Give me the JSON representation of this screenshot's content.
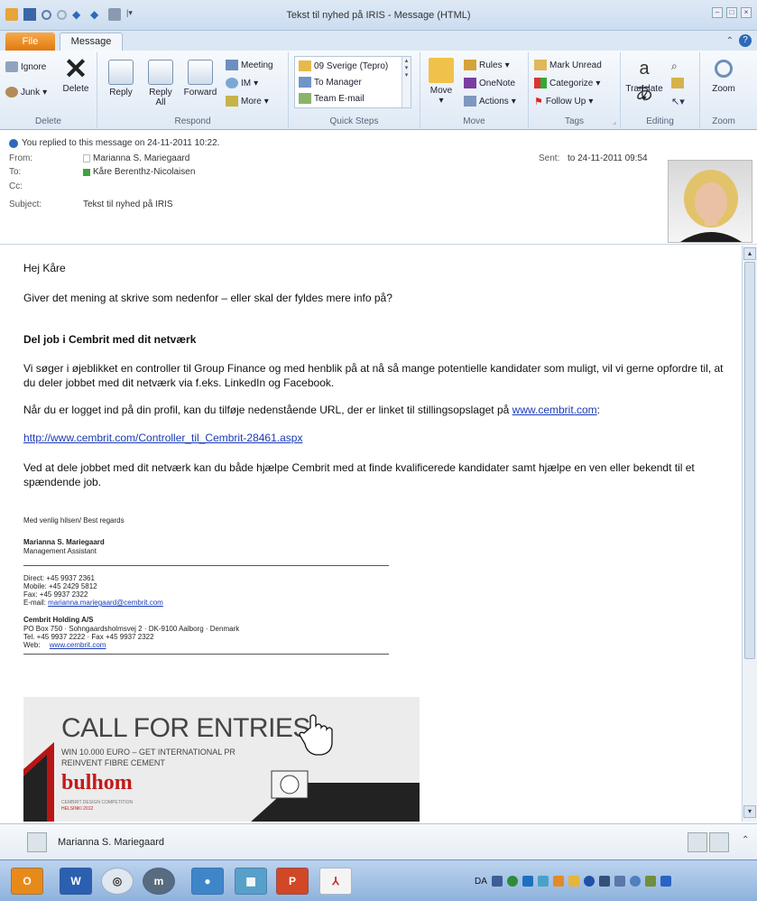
{
  "window": {
    "title": "Tekst til nyhed på IRIS - Message (HTML)"
  },
  "tabs": {
    "file": "File",
    "message": "Message"
  },
  "ribbon": {
    "delete": {
      "ignore": "Ignore",
      "junk": "Junk",
      "delete": "Delete",
      "label": "Delete"
    },
    "respond": {
      "reply": "Reply",
      "reply_all_1": "Reply",
      "reply_all_2": "All",
      "forward": "Forward",
      "meeting": "Meeting",
      "im": "IM",
      "more": "More",
      "label": "Respond"
    },
    "quick_steps": {
      "items": [
        "09 Sverige (Tepro)",
        "To Manager",
        "Team E-mail"
      ],
      "label": "Quick Steps"
    },
    "move": {
      "move": "Move",
      "rules": "Rules",
      "onenote": "OneNote",
      "actions": "Actions",
      "label": "Move"
    },
    "tags": {
      "mark_unread": "Mark Unread",
      "categorize": "Categorize",
      "follow_up": "Follow Up",
      "label": "Tags"
    },
    "editing": {
      "translate": "Translate",
      "label": "Editing"
    },
    "zoom": {
      "zoom": "Zoom",
      "label": "Zoom"
    }
  },
  "header": {
    "info": "You replied to this message on 24-11-2011 10:22.",
    "from_label": "From:",
    "from": "Marianna S. Mariegaard",
    "to_label": "To:",
    "to": "Kåre Berenthz-Nicolaisen",
    "cc_label": "Cc:",
    "subject_label": "Subject:",
    "subject": "Tekst til nyhed på IRIS",
    "sent_label": "Sent:",
    "sent": "to 24-11-2011 09:54"
  },
  "body": {
    "greeting": "Hej Kåre",
    "question": "Giver det mening at skrive som nedenfor – eller skal der fyldes mere info på?",
    "heading": "Del job i Cembrit med dit netværk",
    "para1": "Vi søger i øjeblikket en controller til Group Finance og med henblik på at nå så mange potentielle kandidater som muligt, vil vi gerne opfordre til, at du deler jobbet med dit netværk via f.eks. LinkedIn og Facebook.",
    "para2": "Når du er logget ind på din profil, kan du tilføje nedenstående URL, der er linket til stillingsopslaget på",
    "para2_link": "www.cembrit.com",
    "para2_end": ":",
    "url": "http://www.cembrit.com/Controller_til_Cembrit-28461.aspx",
    "para3": "Ved at dele jobbet med dit netværk kan du både hjælpe Cembrit med at finde kvalificerede kandidater samt hjælpe en ven eller bekendt til et spændende job."
  },
  "signature": {
    "regards": "Med venlig hilsen/ Best regards",
    "name": "Marianna S. Mariegaard",
    "role": "Management Assistant",
    "direct": "Direct: +45 9937 2361",
    "mobile": "Mobile: +45 2429 5812",
    "fax": "Fax: +45 9937 2322",
    "email_label": "E-mail:",
    "email": "marianna.mariegaard@cembrit.com",
    "company": "Cembrit Holding A/S",
    "address": "PO Box 750 · Sohngaardsholmsvej 2 · DK-9100 Aalborg · Denmark",
    "tel": "Tel. +45 9937 2222 · Fax +45 9937 2322",
    "web_label": "Web:",
    "web": "www.cembrit.com"
  },
  "banner": {
    "headline": "CALL FOR ENTRIES!",
    "line1": "WIN 10.000 EURO – GET INTERNATIONAL PR",
    "line2": "REINVENT FIBRE CEMENT",
    "logo": "bulhom",
    "sub1": "CEMBRIT DESIGN COMPETITION",
    "sub2": "HELSINKI 2012"
  },
  "people_pane": {
    "name": "Marianna S. Mariegaard"
  },
  "taskbar": {
    "language": "DA"
  }
}
